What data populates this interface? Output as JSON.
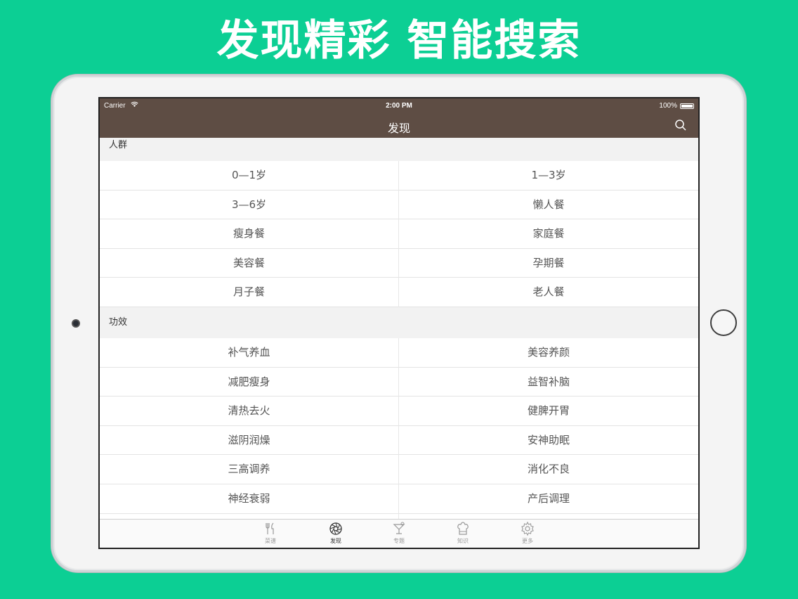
{
  "headline": "发现精彩 智能搜索",
  "status_bar": {
    "carrier": "Carrier",
    "time": "2:00 PM",
    "battery": "100%"
  },
  "nav": {
    "title": "发现"
  },
  "sections": [
    {
      "title": "人群",
      "items": [
        "0—1岁",
        "1—3岁",
        "3—6岁",
        "懒人餐",
        "瘦身餐",
        "家庭餐",
        "美容餐",
        "孕期餐",
        "月子餐",
        "老人餐"
      ]
    },
    {
      "title": "功效",
      "items": [
        "补气养血",
        "美容养颜",
        "减肥瘦身",
        "益智补脑",
        "清热去火",
        "健脾开胃",
        "滋阴润燥",
        "安神助眠",
        "三高调养",
        "消化不良",
        "神经衰弱",
        "产后调理",
        "",
        ""
      ]
    }
  ],
  "tabs": [
    {
      "label": "菜谱",
      "icon": "utensils-icon",
      "active": false
    },
    {
      "label": "发现",
      "icon": "aperture-icon",
      "active": true
    },
    {
      "label": "专题",
      "icon": "cocktail-icon",
      "active": false
    },
    {
      "label": "知识",
      "icon": "chef-hat-icon",
      "active": false
    },
    {
      "label": "更多",
      "icon": "gear-icon",
      "active": false
    }
  ],
  "colors": {
    "background": "#0ccf94",
    "nav_bar": "#5e4d44"
  }
}
